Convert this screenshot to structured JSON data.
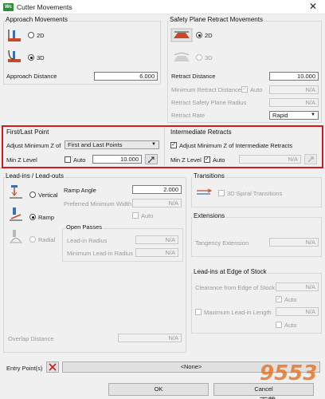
{
  "window": {
    "title": "Cutter Movements",
    "app_badge": "Wc",
    "close_glyph": "✕"
  },
  "approach": {
    "heading": "Approach Movements",
    "option_2d": "2D",
    "option_3d": "3D",
    "selected": "3D",
    "distance_label": "Approach Distance",
    "distance_value": "6.000"
  },
  "safety": {
    "heading": "Safety Plane Retract Movements",
    "option_2d": "2D",
    "option_3d": "3D",
    "selected": "2D",
    "retract_distance_label": "Retract Distance",
    "retract_distance_value": "10.000",
    "min_retract_label": "Minimum Retract Distance",
    "min_retract_auto": "Auto",
    "min_retract_value": "N/A",
    "retract_radius_label": "Retract Safety Plane Radius",
    "retract_radius_value": "N/A",
    "retract_rate_label": "Retract Rate",
    "retract_rate_value": "Rapid"
  },
  "first_last": {
    "heading": "First/Last Point",
    "adjust_label": "Adjust Minimum Z of",
    "adjust_value": "First and Last Points",
    "minz_label": "Min Z Level",
    "auto_label": "Auto",
    "minz_value": "10.000"
  },
  "intermediate": {
    "heading": "Intermediate Retracts",
    "adjust_label": "Adjust Minimum Z of Intermediate Retracts",
    "minz_label": "Min Z Level",
    "auto_label": "Auto",
    "minz_value": "N/A"
  },
  "leadins": {
    "heading": "Lead-ins / Lead-outs",
    "option_vertical": "Vertical",
    "option_ramp": "Ramp",
    "option_radial": "Radial",
    "selected": "Ramp",
    "ramp_angle_label": "Ramp Angle",
    "ramp_angle_value": "2.000",
    "pref_min_width_label": "Preferred Minimum Width",
    "pref_min_width_value": "N/A",
    "auto_label": "Auto",
    "open_passes_heading": "Open Passes",
    "leadin_radius_label": "Lead-in Radius",
    "leadin_radius_value": "N/A",
    "min_leadin_radius_label": "Minimum Lead-in Radius",
    "min_leadin_radius_value": "N/A",
    "overlap_label": "Overlap Distance",
    "overlap_value": "N/A"
  },
  "transitions": {
    "heading": "Transitions",
    "spiral_label": "3D Spiral Transitions"
  },
  "extensions": {
    "heading": "Extensions",
    "tangency_label": "Tangency Extension",
    "tangency_value": "N/A"
  },
  "stock_edge": {
    "heading": "Lead-ins at Edge of Stock",
    "clearance_label": "Clearance from Edge of Stock",
    "clearance_value": "N/A",
    "auto_label": "Auto",
    "max_leadin_label": "Maximum Lead-in Length",
    "max_leadin_value": "N/A",
    "auto2_label": "Auto"
  },
  "entry": {
    "label": "Entry Point(s)",
    "value": "<None>"
  },
  "buttons": {
    "ok": "OK",
    "cancel": "Cancel"
  },
  "watermark": {
    "main": "9553",
    "sub": "下载"
  },
  "colors": {
    "highlight": "#d11a1a",
    "app_badge": "#2e8b3a",
    "watermark": "#e8762a"
  }
}
